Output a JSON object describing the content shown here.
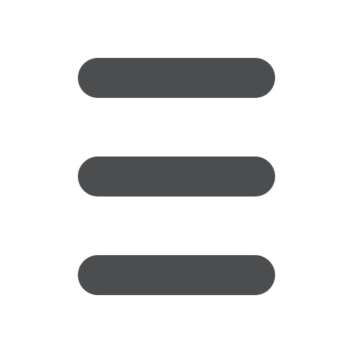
{
  "icon": {
    "name": "hamburger-menu-icon",
    "bar_color": "#4b4d4f",
    "background_color": "#ffffff",
    "bar_count": 3
  }
}
